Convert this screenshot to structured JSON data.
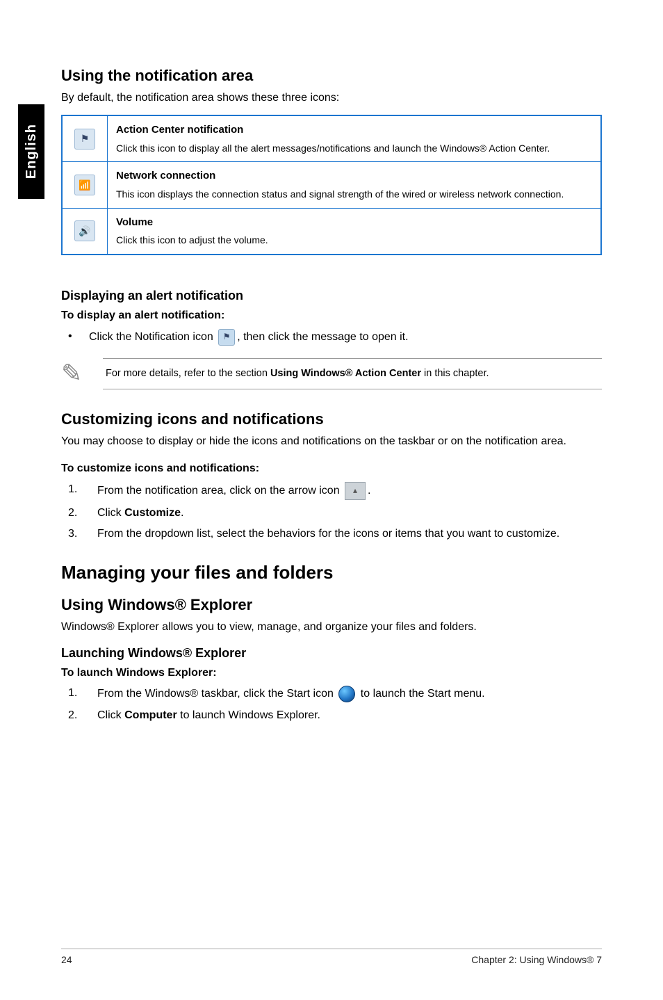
{
  "sideTab": "English",
  "notifArea": {
    "heading": "Using the notification area",
    "intro": "By default, the notification area shows these three icons:",
    "rows": [
      {
        "iconGlyph": "⚑",
        "title": "Action Center notification",
        "desc": "Click this icon to display all the alert messages/notifications and launch the Windows® Action Center."
      },
      {
        "iconGlyph": "📶",
        "title": "Network connection",
        "desc": "This icon displays the connection status and signal strength of the wired or wireless network connection."
      },
      {
        "iconGlyph": "🔊",
        "title": "Volume",
        "desc": "Click this icon to adjust the volume."
      }
    ]
  },
  "alert": {
    "heading": "Displaying an alert notification",
    "sub": "To display an alert notification:",
    "bulletPrefix": "Click the Notification icon ",
    "bulletSuffix": ", then click the message to open it.",
    "iconGlyph": "⚑"
  },
  "note": {
    "prefix": "For more details, refer to the section ",
    "boldPart": "Using Windows® Action Center",
    "suffix": " in this chapter."
  },
  "customize": {
    "heading": "Customizing icons and notifications",
    "intro": "You may choose to display or hide the icons and notifications on the taskbar or on the notification area.",
    "sub": "To customize icons and notifications:",
    "step1Prefix": "From the notification area, click on the arrow icon ",
    "step1Suffix": ".",
    "step2Prefix": "Click ",
    "step2Bold": "Customize",
    "step2Suffix": ".",
    "step3": "From the dropdown list, select the behaviors for the icons or items that you want to customize."
  },
  "managing": {
    "heading": "Managing your files and folders",
    "sub1": "Using Windows® Explorer",
    "sub1Intro": "Windows® Explorer allows you to view, manage, and organize your files and folders.",
    "sub2": "Launching Windows® Explorer",
    "sub2Sub": "To launch Windows Explorer:",
    "step1Prefix": "From the Windows® taskbar, click the Start icon ",
    "step1Suffix": " to launch the Start menu.",
    "step2Prefix": "Click ",
    "step2Bold": "Computer",
    "step2Suffix": " to launch Windows Explorer."
  },
  "footer": {
    "pageNum": "24",
    "chapterLabel": "Chapter 2: Using Windows® 7"
  }
}
